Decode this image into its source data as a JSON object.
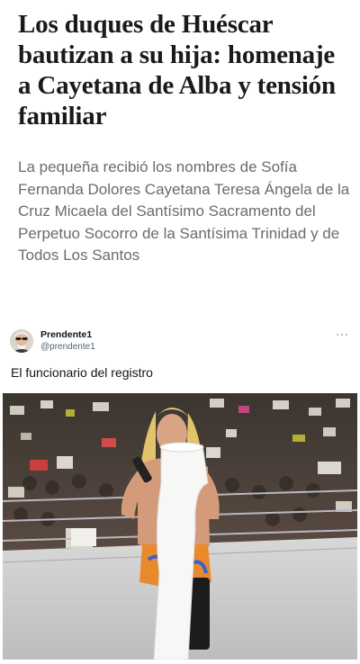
{
  "article": {
    "headline": "Los duques de Huéscar bautizan a su hija: homenaje a Cayetana de Alba y tensión familiar",
    "summary": "La pequeña recibió los nombres de Sofía Fernanda Dolores Cayetana Teresa Ángela de la Cruz Micaela del Santísimo Sacramento del Perpetuo Socorro de la Santísima Trinidad y de Todos Los Santos"
  },
  "tweet": {
    "display_name": "Prendente1",
    "handle": "@prendente1",
    "more_icon": "more-horizontal-icon",
    "more_glyph": "···",
    "text": "El funcionario del registro",
    "media": {
      "description_icon": "wrestler-reading-scroll-photo"
    }
  },
  "colors": {
    "headline": "#1a1a1a",
    "summary": "#6b6b6b",
    "handle": "#536471",
    "text": "#0f1419"
  }
}
